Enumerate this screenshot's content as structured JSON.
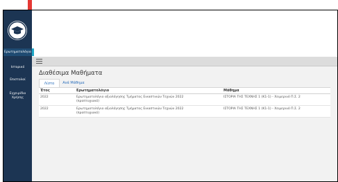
{
  "sidebar": {
    "items": [
      {
        "label": "Ερωτηματολόγια"
      },
      {
        "label": "Ιστορικό"
      },
      {
        "label": "Επιστολαί"
      },
      {
        "label": "Εγχειρίδιο Χρήσης"
      }
    ]
  },
  "main": {
    "title": "Διαθέσιμα Μαθήματα",
    "tabs": [
      {
        "label": "Λίστα"
      },
      {
        "label": "Ανά Μάθημα"
      }
    ],
    "table": {
      "headers": {
        "year": "Έτος",
        "questionnaire": "Ερωτηματολόγιο",
        "course": "Μάθημα"
      },
      "rows": [
        {
          "year": "2022",
          "questionnaire": "Ερωτηματολόγιο αξιολόγησης Τμήματος Εικαστικών Τεχνών 2022 (προπτυχιακό)",
          "course": "ΙΣΤΟΡΙΑ ΤΗΣ ΤΕΧΝΗΣ 1 (Κ1-1) - Χειμερινό Π.Σ. 2"
        },
        {
          "year": "2022",
          "questionnaire": "Ερωτηματολόγιο αξιολόγησης Τμήματος Εικαστικών Τεχνών 2022 (προπτυχιακό)",
          "course": "ΙΣΤΟΡΙΑ ΤΗΣ ΤΕΧΝΗΣ 1 (Κ1-1) - Χειμερινό Π.Σ. 2"
        }
      ]
    }
  },
  "colors": {
    "sidebar": "#1c3553",
    "accent": "#21a8c7",
    "arrow": "#e53935"
  }
}
